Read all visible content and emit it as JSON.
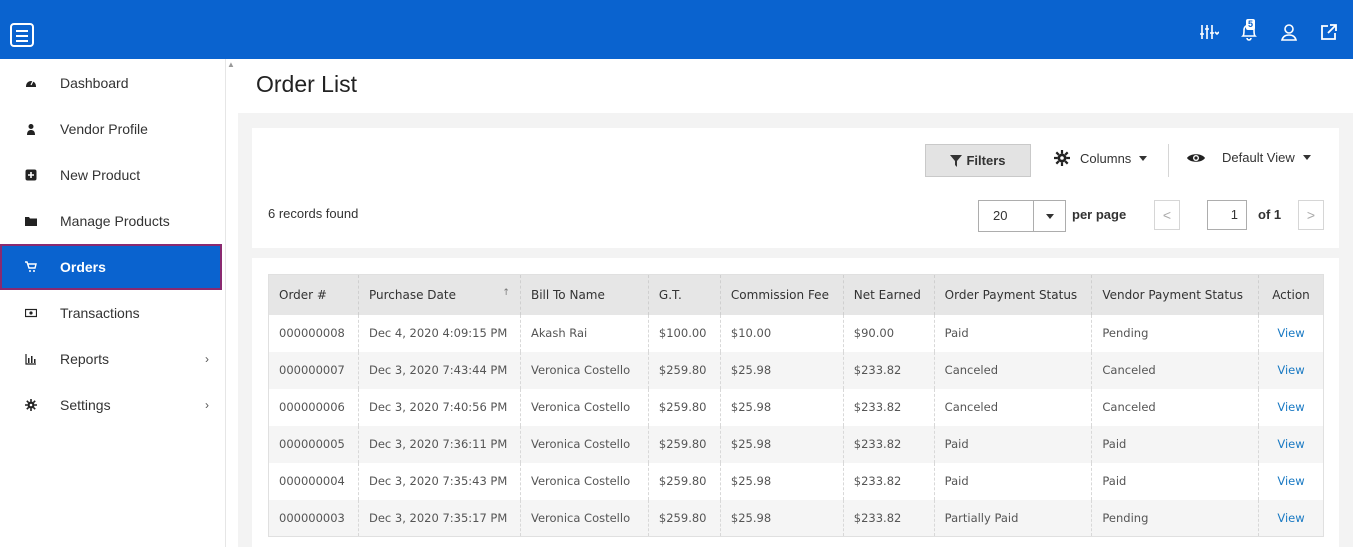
{
  "header": {
    "icons": [
      "menu-icon",
      "sliders-icon",
      "notification-bell-icon",
      "user-icon",
      "external-link-icon"
    ],
    "notification_count": "5",
    "brand_color": "#0a63cf"
  },
  "sidebar": {
    "items": [
      {
        "label": "Dashboard",
        "icon": "dashboard-icon"
      },
      {
        "label": "Vendor Profile",
        "icon": "user-icon"
      },
      {
        "label": "New Product",
        "icon": "plus-square-icon"
      },
      {
        "label": "Manage Products",
        "icon": "folder-icon"
      },
      {
        "label": "Orders",
        "icon": "cart-icon",
        "active": true
      },
      {
        "label": "Transactions",
        "icon": "money-icon"
      },
      {
        "label": "Reports",
        "icon": "bar-chart-icon",
        "chevron": "›"
      },
      {
        "label": "Settings",
        "icon": "gear-icon",
        "chevron": "›"
      }
    ],
    "active_border_color": "#8a2a70"
  },
  "main": {
    "title": "Order List",
    "toolbar": {
      "filters_label": "Filters",
      "columns_label": "Columns",
      "view_label": "Default View"
    },
    "records_found": "6 records found",
    "pagination": {
      "per_page_value": "20",
      "per_page_label": "per page",
      "prev": "<",
      "current_page": "1",
      "of_label": "of 1",
      "next": ">"
    },
    "table": {
      "columns": [
        "Order #",
        "Purchase Date",
        "Bill To Name",
        "G.T.",
        "Commission Fee",
        "Net Earned",
        "Order Payment Status",
        "Vendor Payment Status",
        "Action"
      ],
      "sort_indicator": "↑",
      "rows": [
        [
          "000000008",
          "Dec 4, 2020 4:09:15 PM",
          "Akash Rai",
          "$100.00",
          "$10.00",
          "$90.00",
          "Paid",
          "Pending",
          "View"
        ],
        [
          "000000007",
          "Dec 3, 2020 7:43:44 PM",
          "Veronica Costello",
          "$259.80",
          "$25.98",
          "$233.82",
          "Canceled",
          "Canceled",
          "View"
        ],
        [
          "000000006",
          "Dec 3, 2020 7:40:56 PM",
          "Veronica Costello",
          "$259.80",
          "$25.98",
          "$233.82",
          "Canceled",
          "Canceled",
          "View"
        ],
        [
          "000000005",
          "Dec 3, 2020 7:36:11 PM",
          "Veronica Costello",
          "$259.80",
          "$25.98",
          "$233.82",
          "Paid",
          "Paid",
          "View"
        ],
        [
          "000000004",
          "Dec 3, 2020 7:35:43 PM",
          "Veronica Costello",
          "$259.80",
          "$25.98",
          "$233.82",
          "Paid",
          "Paid",
          "View"
        ],
        [
          "000000003",
          "Dec 3, 2020 7:35:17 PM",
          "Veronica Costello",
          "$259.80",
          "$25.98",
          "$233.82",
          "Partially Paid",
          "Pending",
          "View"
        ]
      ]
    }
  }
}
